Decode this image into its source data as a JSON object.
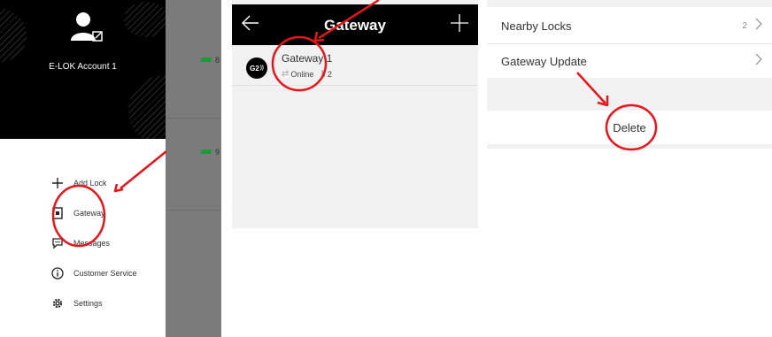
{
  "drawer": {
    "account_name": "E-LOK Account 1",
    "menu": [
      {
        "icon": "plus-icon",
        "label": "Add Lock"
      },
      {
        "icon": "gateway-icon",
        "label": "Gateway"
      },
      {
        "icon": "message-icon",
        "label": "Messages"
      },
      {
        "icon": "info-icon",
        "label": "Customer Service"
      },
      {
        "icon": "gear-icon",
        "label": "Settings"
      }
    ],
    "background_battery": [
      "8",
      "9"
    ]
  },
  "gateway_list": {
    "title": "Gateway",
    "back_icon": "arrow-left-icon",
    "add_icon": "plus-icon",
    "items": [
      {
        "logo": "G2",
        "name": "Gateway 1",
        "status": "Online",
        "lock_count": "2"
      }
    ]
  },
  "gateway_settings": {
    "rows": [
      {
        "label": "Nearby Locks",
        "value": "2"
      },
      {
        "label": "Gateway Update",
        "value": ""
      }
    ],
    "delete_label": "Delete"
  },
  "colors": {
    "annotation": "#e8151b",
    "header_bg": "#000000",
    "online_battery": "#1f9a3a"
  }
}
